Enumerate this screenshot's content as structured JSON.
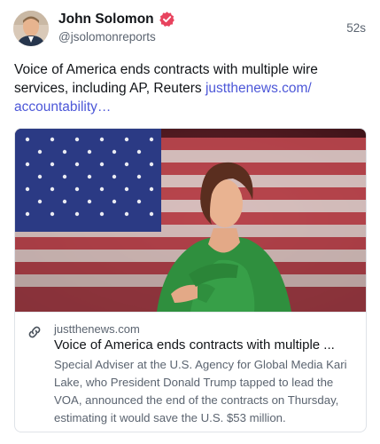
{
  "author": {
    "name": "John Solomon",
    "handle": "@jsolomonreports",
    "verified_icon": "verified-badge-icon",
    "avatar_icon": "avatar"
  },
  "post": {
    "time": "52s",
    "text": "Voice of America ends contracts with multiple wire services, including AP, Reuters ",
    "link_text": "justthenews.com/ accountability…"
  },
  "card": {
    "image_alt": "photo",
    "domain": "justthenews.com",
    "title": "Voice of America ends contracts with multiple ...",
    "description": "Special Adviser at the U.S. Agency for Global Media Kari Lake, who President Donald Trump tapped to lead the VOA, announced the end of the contracts on Thursday, estimating it would save the U.S. $53 million.",
    "link_icon": "link-icon"
  },
  "colors": {
    "accent_link": "#4c57d8",
    "verified": "#e8435e",
    "muted_text": "#5b6470"
  }
}
